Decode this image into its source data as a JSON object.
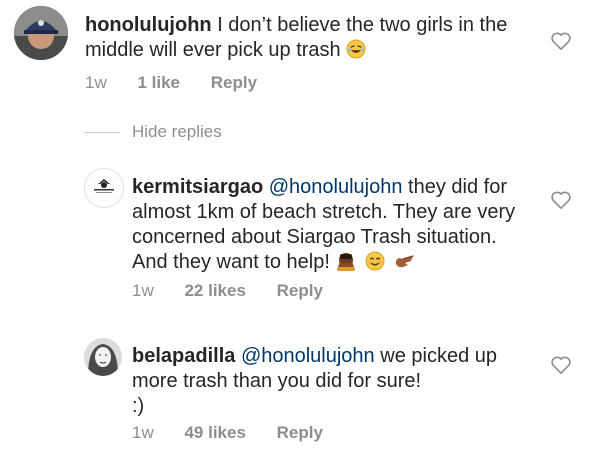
{
  "comments": [
    {
      "username": "honolulujohn",
      "text": "I don’t believe the two girls in the middle will ever pick up trash",
      "emojis": [
        "laughing-face"
      ],
      "time": "1w",
      "likes": "1 like",
      "reply": "Reply",
      "avatar": "avatar-cap-man"
    }
  ],
  "hide_replies": "Hide replies",
  "replies": [
    {
      "username": "kermitsiargao",
      "mention": "@honolulujohn",
      "text": "they did for almost 1km of beach stretch. They are very concerned about Siargao Trash situation. And they want to help!",
      "emojis": [
        "hands-covering-face",
        "smiling-face",
        "pointing-hand"
      ],
      "time": "1w",
      "likes": "22 likes",
      "reply": "Reply",
      "avatar": "avatar-logo"
    },
    {
      "username": "belapadilla",
      "mention": "@honolulujohn",
      "text": "we picked up more trash than you did for sure!",
      "text2": ":)",
      "time": "1w",
      "likes": "49 likes",
      "reply": "Reply",
      "avatar": "avatar-sketch-woman"
    }
  ],
  "colors": {
    "text": "#262626",
    "mention": "#00376b",
    "meta": "#8e8e8e",
    "divider": "#c7c7c7"
  },
  "icons": [
    "heart-icon"
  ]
}
